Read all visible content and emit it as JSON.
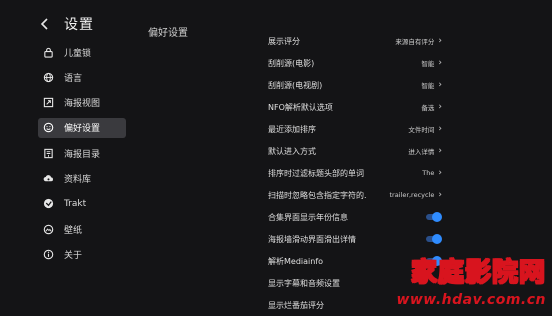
{
  "header": {
    "title": "设置"
  },
  "sidebar": {
    "items": [
      {
        "label": "儿童锁",
        "icon": "lock-icon"
      },
      {
        "label": "语言",
        "icon": "globe-icon"
      },
      {
        "label": "海报视图",
        "icon": "expand-icon"
      },
      {
        "label": "偏好设置",
        "icon": "smiley-icon",
        "active": true
      },
      {
        "label": "海报目录",
        "icon": "catalog-icon"
      },
      {
        "label": "资料库",
        "icon": "cloud-icon"
      },
      {
        "label": "Trakt",
        "icon": "trakt-icon"
      },
      {
        "label": "壁纸",
        "icon": "wallpaper-icon"
      },
      {
        "label": "关于",
        "icon": "info-icon"
      }
    ]
  },
  "main": {
    "section_title": "偏好设置",
    "rows": [
      {
        "label": "展示评分",
        "value": "来源自有评分"
      },
      {
        "label": "刮削源(电影)",
        "value": "智能"
      },
      {
        "label": "刮削源(电视剧)",
        "value": "智能"
      },
      {
        "label": "NFO解析默认选项",
        "value": "备选"
      },
      {
        "label": "最近添加排序",
        "value": "文件时间"
      },
      {
        "label": "默认进入方式",
        "value": "进入详情"
      },
      {
        "label": "排序时过滤标题头部的单词",
        "value": "The"
      },
      {
        "label": "扫描时忽略包含指定字符的.",
        "value": "trailer,recycle"
      },
      {
        "label": "合集界面显示年份信息",
        "toggle": true
      },
      {
        "label": "海报墙滑动界面滑出详情",
        "toggle": true
      },
      {
        "label": "解析Mediainfo",
        "toggle": true
      },
      {
        "label": "显示字幕和音频设置"
      },
      {
        "label": "显示烂番茄评分"
      }
    ]
  },
  "watermark": {
    "title": "家庭影院网",
    "url": "www.hdav.com.cn"
  },
  "colors": {
    "accent": "#2f8cff",
    "active_bg": "#3a3a3e",
    "watermark_red": "#d8141e"
  }
}
